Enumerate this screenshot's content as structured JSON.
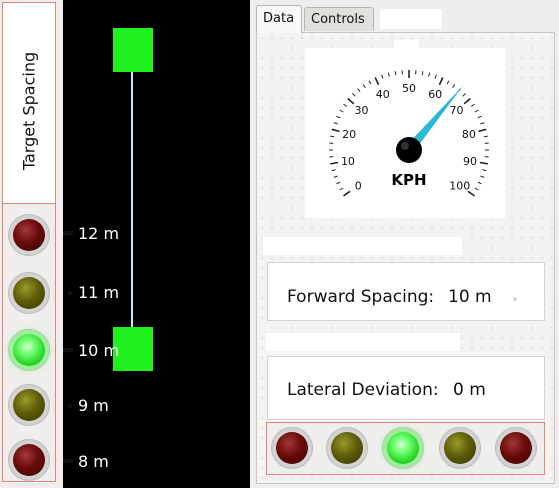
{
  "target_spacing": {
    "title": "Target Spacing",
    "lights": [
      "red",
      "yellow",
      "green",
      "yellow",
      "red"
    ]
  },
  "scale": {
    "labels": [
      "12 m",
      "11 m",
      "10 m",
      "9 m",
      "8 m"
    ]
  },
  "tabs": [
    "Data",
    "Controls"
  ],
  "speedometer": {
    "unit": "KPH",
    "tick_labels": [
      "0",
      "10",
      "20",
      "30",
      "40",
      "50",
      "60",
      "70",
      "80",
      "90",
      "100"
    ],
    "min": 0,
    "max": 100,
    "value": 66,
    "needle_color": "#29b8d8"
  },
  "forward_spacing": {
    "label": "Forward Spacing:",
    "value": "10 m"
  },
  "lateral_deviation": {
    "label": "Lateral Deviation:",
    "value": "0 m"
  },
  "lateral_lights": [
    "red",
    "yellow",
    "green",
    "yellow",
    "red"
  ],
  "colors": {
    "vehicle": "#1ff21f",
    "track_line": "#b8f1f5",
    "panel_border": "#e0857c"
  }
}
